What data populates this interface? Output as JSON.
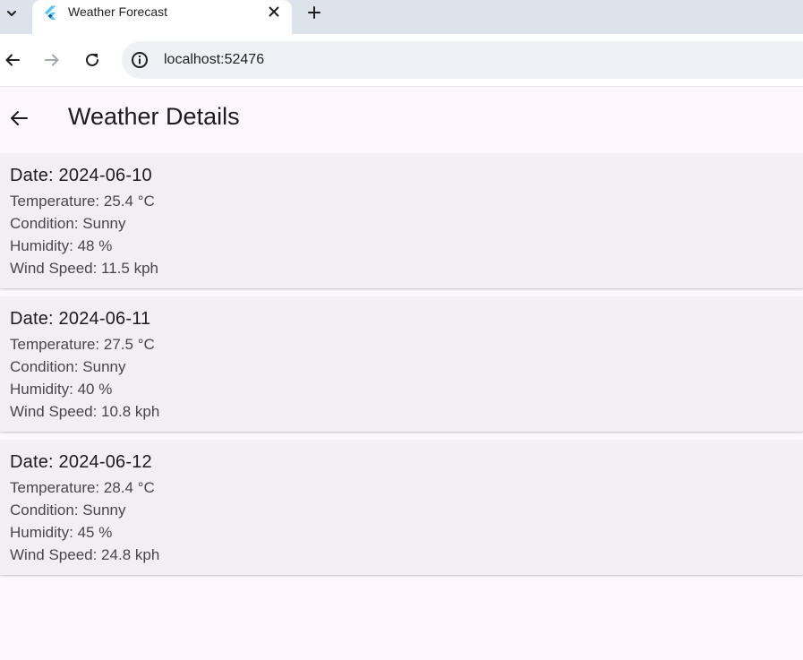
{
  "browser": {
    "tab_title": "Weather Forecast",
    "url": "localhost:52476"
  },
  "icons": {
    "tab_search": "chevron-down-icon",
    "favicon": "flutter-logo-icon",
    "close": "close-icon",
    "new_tab": "plus-icon",
    "back": "arrow-left-icon",
    "forward": "arrow-right-icon",
    "reload": "reload-icon",
    "site_info": "info-icon"
  },
  "colors": {
    "page_background": "#fdf7fc",
    "card_background": "#f3edf4",
    "tabstrip_background": "#dee3eb",
    "omnibox_background": "#eef1f6",
    "primary_text": "#1d1b20",
    "secondary_text": "#49454f",
    "flutter_light_blue": "#54c5f8",
    "flutter_dark_blue": "#01579b"
  },
  "app": {
    "title": "Weather Details",
    "forecasts": [
      {
        "date": "Date: 2024-06-10",
        "temperature": "Temperature: 25.4 °C",
        "condition": "Condition: Sunny",
        "humidity": "Humidity: 48 %",
        "wind_speed": "Wind Speed: 11.5 kph"
      },
      {
        "date": "Date: 2024-06-11",
        "temperature": "Temperature: 27.5 °C",
        "condition": "Condition: Sunny",
        "humidity": "Humidity: 40 %",
        "wind_speed": "Wind Speed: 10.8 kph"
      },
      {
        "date": "Date: 2024-06-12",
        "temperature": "Temperature: 28.4 °C",
        "condition": "Condition: Sunny",
        "humidity": "Humidity: 45 %",
        "wind_speed": "Wind Speed: 24.8 kph"
      }
    ]
  }
}
